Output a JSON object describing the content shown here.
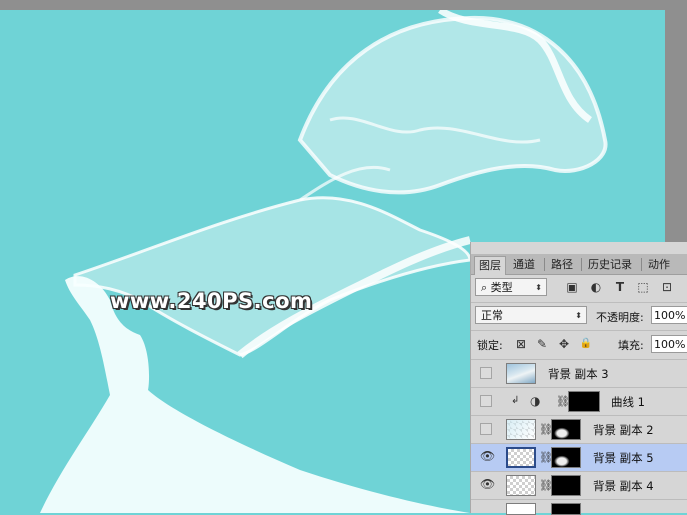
{
  "canvas": {
    "background": "#6fd3d6",
    "watermark": "www.240PS.com"
  },
  "panel": {
    "tabs": [
      {
        "label": "图层"
      },
      {
        "label": "通道"
      },
      {
        "label": "路径"
      },
      {
        "label": "历史记录"
      },
      {
        "label": "动作"
      }
    ],
    "filter": {
      "kind_label": "类型",
      "search_icon": "⌕",
      "arrow": "⬍",
      "icons": [
        "▣",
        "◐",
        "T",
        "⬚",
        "⊡"
      ]
    },
    "blend_mode": "正常",
    "opacity_label": "不透明度:",
    "opacity_value": "100%",
    "lock_label": "锁定:",
    "lock_icons": [
      "⊠",
      "✎",
      "✥",
      "🔒"
    ],
    "fill_label": "填充:",
    "fill_value": "100%",
    "layers": [
      {
        "name": "背景 副本 3",
        "visible": false,
        "selected": false
      },
      {
        "name": "曲线 1",
        "visible": false,
        "selected": false
      },
      {
        "name": "背景 副本 2",
        "visible": false,
        "selected": false
      },
      {
        "name": "背景 副本 5",
        "visible": true,
        "selected": true
      },
      {
        "name": "背景 副本 4",
        "visible": true,
        "selected": false
      }
    ]
  }
}
